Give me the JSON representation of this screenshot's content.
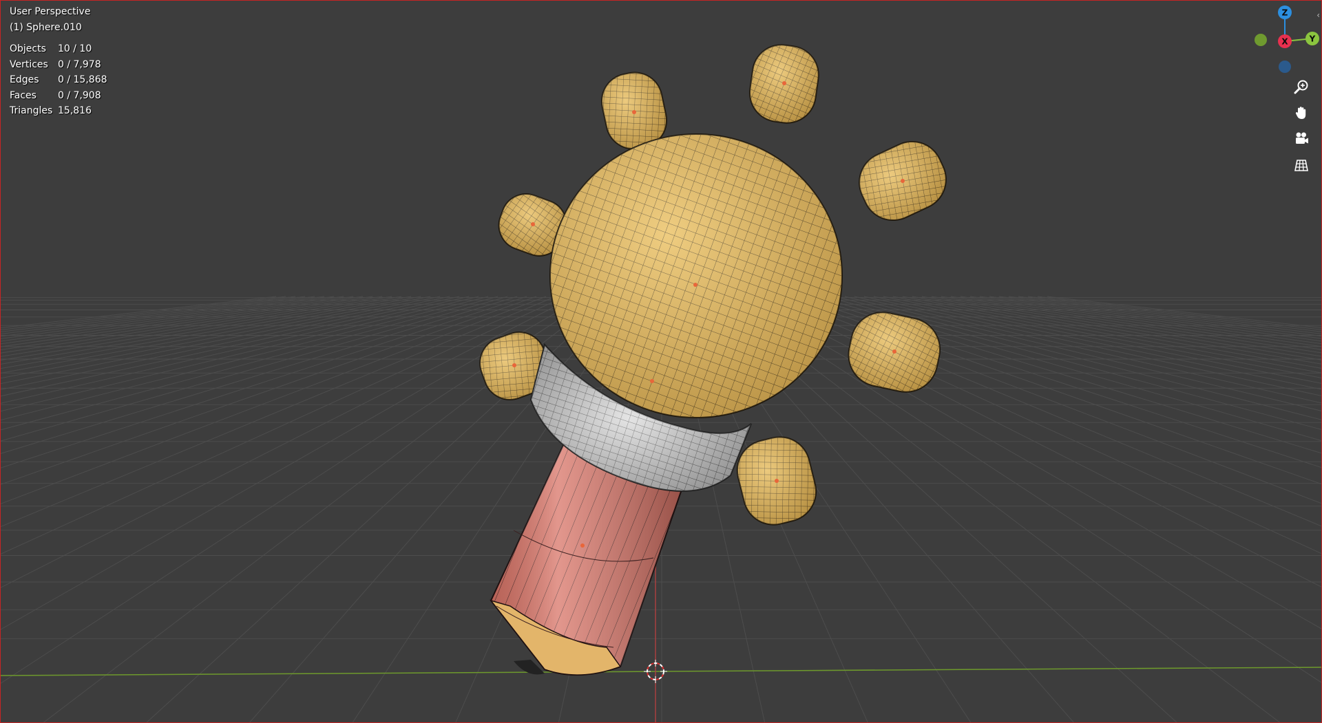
{
  "viewport": {
    "view_name": "User Perspective",
    "active_object": "(1) Sphere.010",
    "stats": [
      {
        "label": "Objects",
        "value": "10 / 10"
      },
      {
        "label": "Vertices",
        "value": "0 / 7,978"
      },
      {
        "label": "Edges",
        "value": "0 / 15,868"
      },
      {
        "label": "Faces",
        "value": "0 / 7,908"
      },
      {
        "label": "Triangles",
        "value": "15,816"
      }
    ]
  },
  "gizmo": {
    "z_label": "Z",
    "y_label": "Y",
    "x_label": "X",
    "colors": {
      "x": "#e8304f",
      "y": "#8bc53f",
      "z": "#2c8fe0",
      "neg_y": "#6f9a2f",
      "neg_z": "#2b5a8c"
    }
  },
  "nav_tools": [
    {
      "name": "zoom-icon"
    },
    {
      "name": "pan-hand-icon"
    },
    {
      "name": "camera-icon"
    },
    {
      "name": "grid-view-icon"
    }
  ],
  "colors": {
    "background": "#3d3d3d",
    "bulb": "#e6b85a",
    "ring": "#c9c9c9",
    "body": "#d97467",
    "tip": "#e3b56a",
    "wire": "#3b2e19",
    "origin": "#e8663a"
  }
}
